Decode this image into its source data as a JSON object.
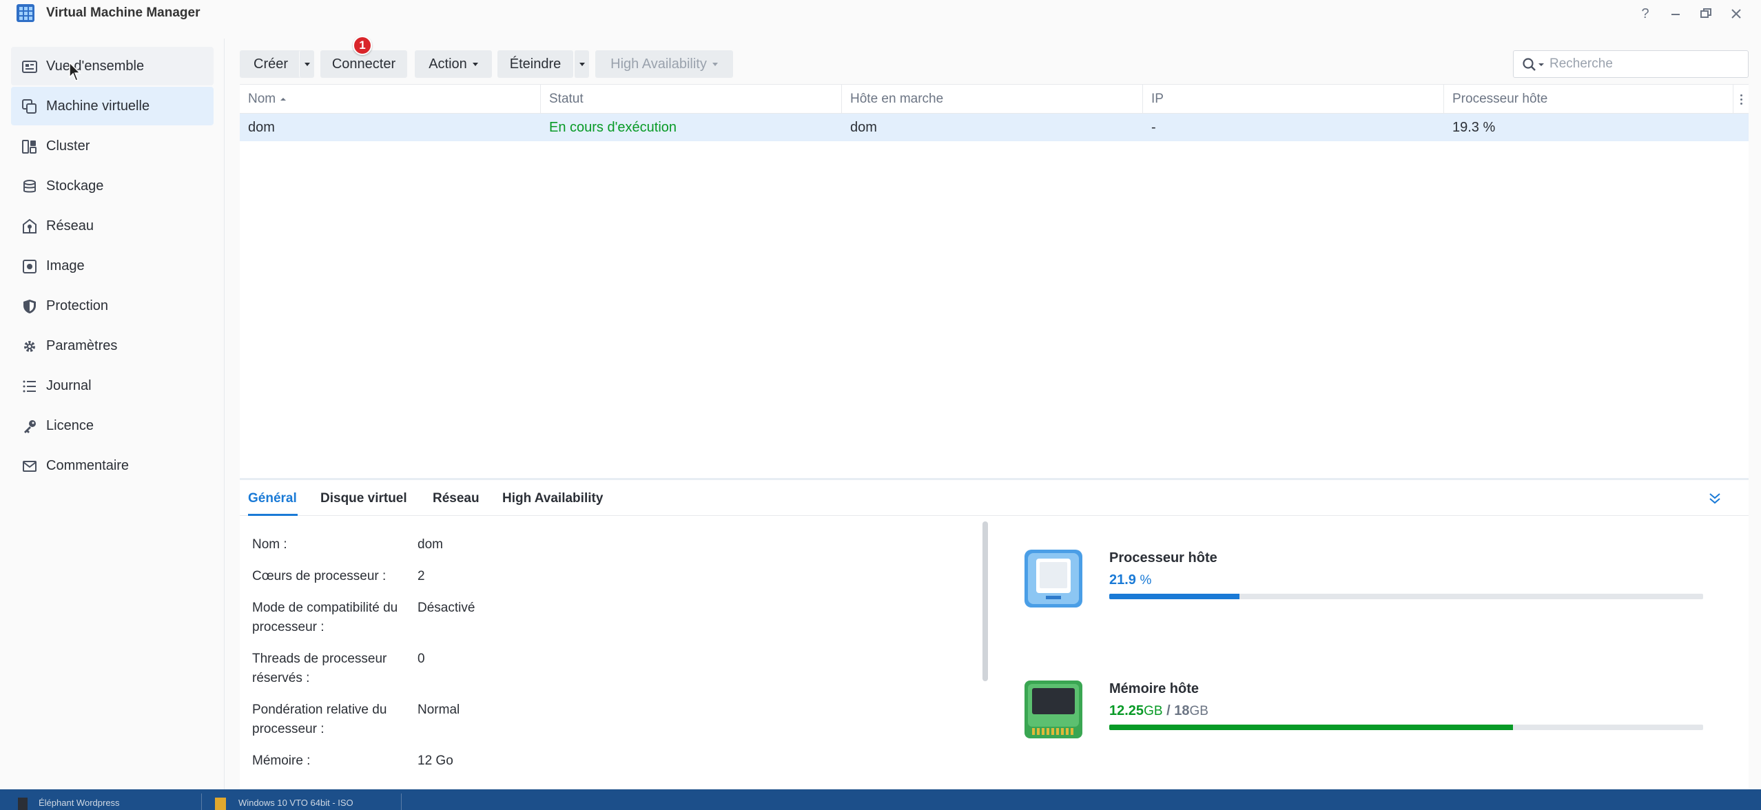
{
  "window": {
    "title": "Virtual Machine Manager",
    "controls": [
      "help-icon",
      "minimize-icon",
      "restore-icon",
      "close-icon"
    ]
  },
  "sidebar": {
    "items": [
      {
        "label": "Vue d'ensemble",
        "icon": "overview-icon"
      },
      {
        "label": "Machine virtuelle",
        "icon": "virtual-machine-icon"
      },
      {
        "label": "Cluster",
        "icon": "cluster-icon"
      },
      {
        "label": "Stockage",
        "icon": "storage-icon"
      },
      {
        "label": "Réseau",
        "icon": "network-icon"
      },
      {
        "label": "Image",
        "icon": "image-icon"
      },
      {
        "label": "Protection",
        "icon": "shield-icon"
      },
      {
        "label": "Paramètres",
        "icon": "gear-icon"
      },
      {
        "label": "Journal",
        "icon": "log-list-icon"
      },
      {
        "label": "Licence",
        "icon": "key-icon"
      },
      {
        "label": "Commentaire",
        "icon": "envelope-icon"
      }
    ],
    "active_index": 1
  },
  "toolbar": {
    "create": "Créer",
    "connect": "Connecter",
    "connect_badge": "1",
    "action": "Action",
    "shutdown": "Éteindre",
    "high_availability": "High Availability",
    "search_placeholder": "Recherche"
  },
  "table": {
    "columns": [
      "Nom",
      "Statut",
      "Hôte en marche",
      "IP",
      "Processeur hôte"
    ],
    "sort_column": "Nom",
    "rows": [
      {
        "name": "dom",
        "status": "En cours d'exécution",
        "host": "dom",
        "ip": "-",
        "cpu": "19.3 %"
      }
    ]
  },
  "details": {
    "tabs": [
      "Général",
      "Disque virtuel",
      "Réseau",
      "High Availability"
    ],
    "active_tab": 0,
    "properties": [
      {
        "label": "Nom :",
        "value": "dom"
      },
      {
        "label": "Cœurs de processeur :",
        "value": "2"
      },
      {
        "label": "Mode de compatibilité du processeur :",
        "value": "Désactivé"
      },
      {
        "label": "Threads de processeur réservés :",
        "value": "0"
      },
      {
        "label": "Pondération relative du processeur :",
        "value": "Normal"
      },
      {
        "label": "Mémoire :",
        "value": "12 Go"
      }
    ],
    "cpu": {
      "title": "Processeur hôte",
      "value": "21.9",
      "unit": "%",
      "fraction": 0.219,
      "color": "#1a7ad6"
    },
    "memory": {
      "title": "Mémoire hôte",
      "used": "12.25",
      "used_unit": "GB",
      "separator": "/",
      "total": "18",
      "total_unit": "GB",
      "fraction": 0.68,
      "color": "#089a26"
    }
  },
  "colors": {
    "accent": "#1a7ad6",
    "running": "#089a26",
    "badge": "#d9252a",
    "taskbar": "#1c4f8a"
  },
  "taskbar": {
    "items": [
      "Éléphant Wordpress",
      "Windows 10 VTO 64bit - ISO"
    ]
  }
}
